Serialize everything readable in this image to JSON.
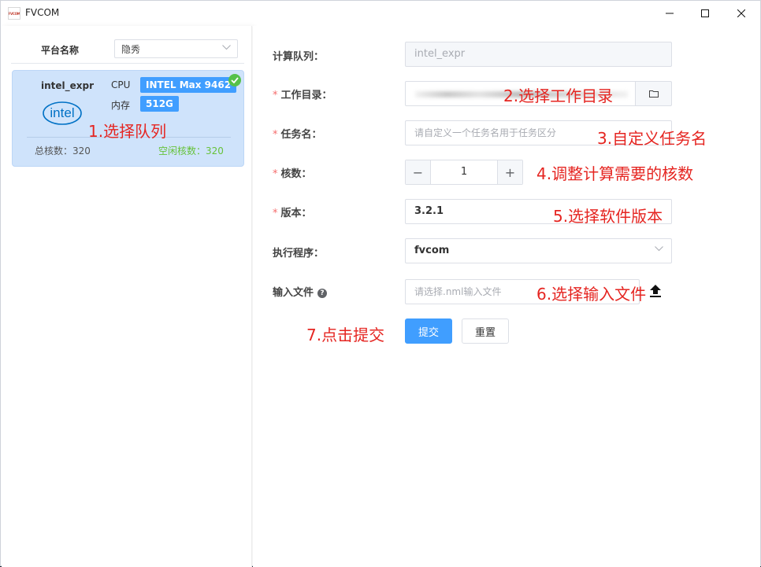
{
  "window": {
    "title": "FVCOM",
    "logo_text": "FVCOM"
  },
  "sidebar": {
    "platform_label": "平台名称",
    "platform_value": "隐秀",
    "queue": {
      "name": "intel_expr",
      "logo_text": "intel",
      "cpu_label": "CPU",
      "cpu_value": "INTEL Max 9462",
      "mem_label": "内存",
      "mem_value": "512G",
      "total_cores": "总核数：320",
      "free_cores": "空闲核数：320"
    }
  },
  "form": {
    "queue_label": "计算队列：",
    "queue_value": "intel_expr",
    "workdir_label": "工作目录：",
    "taskname_label": "任务名：",
    "taskname_placeholder": "请自定义一个任务名用于任务区分",
    "cores_label": "核数：",
    "cores_value": "1",
    "version_label": "版本：",
    "version_value": "3.2.1",
    "exec_label": "执行程序：",
    "exec_value": "fvcom",
    "input_label": "输入文件",
    "input_placeholder": "请选择.nml输入文件",
    "help_glyph": "?",
    "submit_label": "提交",
    "reset_label": "重置",
    "required_mark": "*",
    "minus_glyph": "−",
    "plus_glyph": "+"
  },
  "annotations": {
    "step1": "1.选择队列",
    "step2": "2.选择工作目录",
    "step3": "3.自定义任务名",
    "step4": "4.调整计算需要的核数",
    "step5": "5.选择软件版本",
    "step6": "6.选择输入文件",
    "step7": "7.点击提交"
  },
  "colors": {
    "accent": "#409eff",
    "annotation": "#e52521",
    "success": "#67c23a",
    "card_bg": "#cfe3fb"
  }
}
